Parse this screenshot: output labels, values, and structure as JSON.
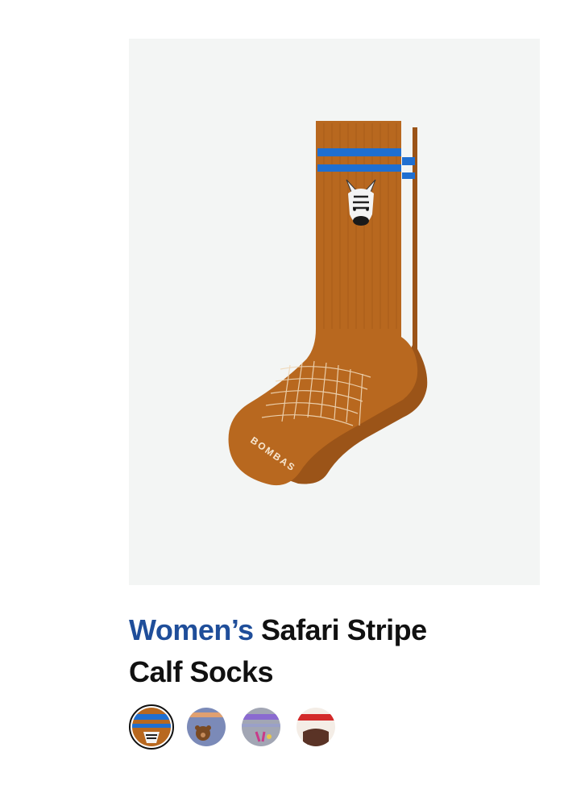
{
  "product": {
    "title_prefix": "Women’s",
    "title_rest": " Safari Stripe Calf Socks",
    "sock_brand_text": "BOMBAS",
    "image_icon": "zebra-sock-image",
    "swatches": [
      {
        "icon": "zebra-sock-swatch",
        "selected": true
      },
      {
        "icon": "bear-sock-swatch",
        "selected": false
      },
      {
        "icon": "purple-sock-swatch",
        "selected": false
      },
      {
        "icon": "red-cream-sock-swatch",
        "selected": false
      }
    ]
  },
  "colors": {
    "gender_accent": "#1f4e9a",
    "sock_body": "#b8681f",
    "stripe": "#1f6fd1",
    "image_bg": "#f3f5f4"
  }
}
